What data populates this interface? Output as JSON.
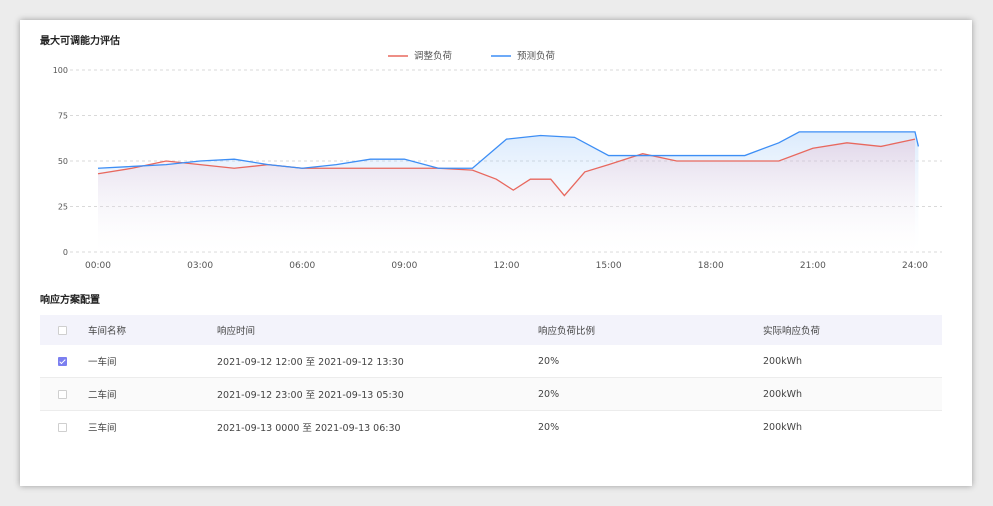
{
  "chart_section": {
    "title": "最大可调能力评估"
  },
  "table_section": {
    "title": "响应方案配置"
  },
  "chart_data": {
    "type": "area",
    "title": "",
    "xlabel": "",
    "ylabel": "",
    "ylim": [
      0,
      100
    ],
    "yticks": [
      0,
      25,
      50,
      75,
      100
    ],
    "xticks": [
      "00:00",
      "03:00",
      "06:00",
      "09:00",
      "12:00",
      "15:00",
      "18:00",
      "21:00",
      "24:00"
    ],
    "xlim": [
      0,
      24
    ],
    "grid": "horizontal-dashed",
    "legend_position": "top-center",
    "series": [
      {
        "name": "调整负荷",
        "color": "#e8685e",
        "x": [
          0,
          1,
          2,
          3,
          4,
          5,
          6,
          7,
          8,
          9,
          10,
          11,
          11.7,
          12.2,
          12.7,
          13.3,
          13.7,
          14.3,
          15,
          16,
          17,
          18,
          19,
          20,
          21,
          22,
          23,
          24
        ],
        "y": [
          43,
          46,
          50,
          48,
          46,
          48,
          46,
          46,
          46,
          46,
          46,
          45,
          40,
          34,
          40,
          40,
          31,
          44,
          48,
          54,
          50,
          50,
          50,
          50,
          57,
          60,
          58,
          62
        ]
      },
      {
        "name": "预测负荷",
        "color": "#3d8ef5",
        "x": [
          0,
          1,
          2,
          3,
          4,
          5,
          6,
          7,
          8,
          9,
          10,
          11,
          12,
          13,
          14,
          15,
          16,
          17,
          18,
          19,
          20,
          20.6,
          21,
          22,
          23,
          24,
          24.1
        ],
        "y": [
          46,
          47,
          48,
          50,
          51,
          48,
          46,
          48,
          51,
          51,
          46,
          46,
          62,
          64,
          63,
          53,
          53,
          53,
          53,
          53,
          60,
          66,
          66,
          66,
          66,
          66,
          58
        ]
      }
    ]
  },
  "table": {
    "headers": {
      "name": "车间名称",
      "time": "响应时间",
      "ratio": "响应负荷比例",
      "load": "实际响应负荷"
    },
    "rows": [
      {
        "checked": true,
        "name": "一车间",
        "time": "2021-09-12 12:00 至 2021-09-12 13:30",
        "ratio": "20%",
        "load": "200kWh"
      },
      {
        "checked": false,
        "name": "二车间",
        "time": "2021-09-12 23:00 至 2021-09-13 05:30",
        "ratio": "20%",
        "load": "200kWh"
      },
      {
        "checked": false,
        "name": "三车间",
        "time": "2021-09-13 0000 至 2021-09-13 06:30",
        "ratio": "20%",
        "load": "200kWh"
      }
    ]
  }
}
